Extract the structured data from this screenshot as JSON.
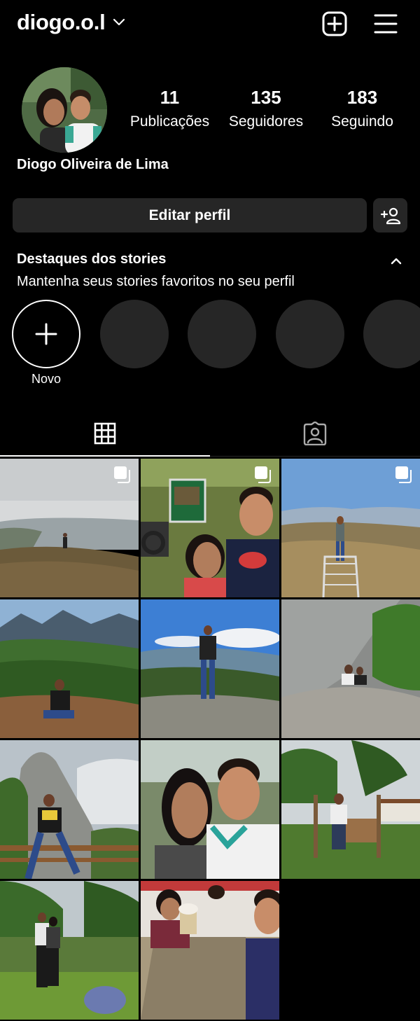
{
  "header": {
    "username": "diogo.o.l",
    "icons": [
      "chevron-down-icon",
      "new-post-icon",
      "menu-icon"
    ]
  },
  "profile": {
    "full_name": "Diogo Oliveira de Lima",
    "stats": [
      {
        "value": "11",
        "label": "Publicações"
      },
      {
        "value": "135",
        "label": "Seguidores"
      },
      {
        "value": "183",
        "label": "Seguindo"
      }
    ],
    "edit_label": "Editar perfil"
  },
  "highlights": {
    "title": "Destaques dos stories",
    "subtitle": "Mantenha seus stories favoritos no seu perfil",
    "new_label": "Novo"
  },
  "tabs": [
    {
      "name": "posts-grid",
      "icon": "grid-icon",
      "active": true
    },
    {
      "name": "tagged",
      "icon": "tagged-icon",
      "active": false
    }
  ],
  "posts": [
    {
      "scene": "coast-overlook",
      "multi": true
    },
    {
      "scene": "couple-selfie-sign",
      "multi": true
    },
    {
      "scene": "mountain-ramp",
      "multi": true
    },
    {
      "scene": "mountain-valley-crouch",
      "multi": false
    },
    {
      "scene": "standing-rock-sky",
      "multi": false
    },
    {
      "scene": "rock-face-sitting",
      "multi": false
    },
    {
      "scene": "rock-peak-railing",
      "multi": false
    },
    {
      "scene": "couple-selfie",
      "multi": false
    },
    {
      "scene": "garden-bench",
      "multi": false
    },
    {
      "scene": "couple-garden",
      "multi": false
    },
    {
      "scene": "restaurant-table",
      "multi": false
    }
  ],
  "colors": {
    "background": "#000000",
    "surface": "#262626",
    "text": "#ffffff"
  }
}
